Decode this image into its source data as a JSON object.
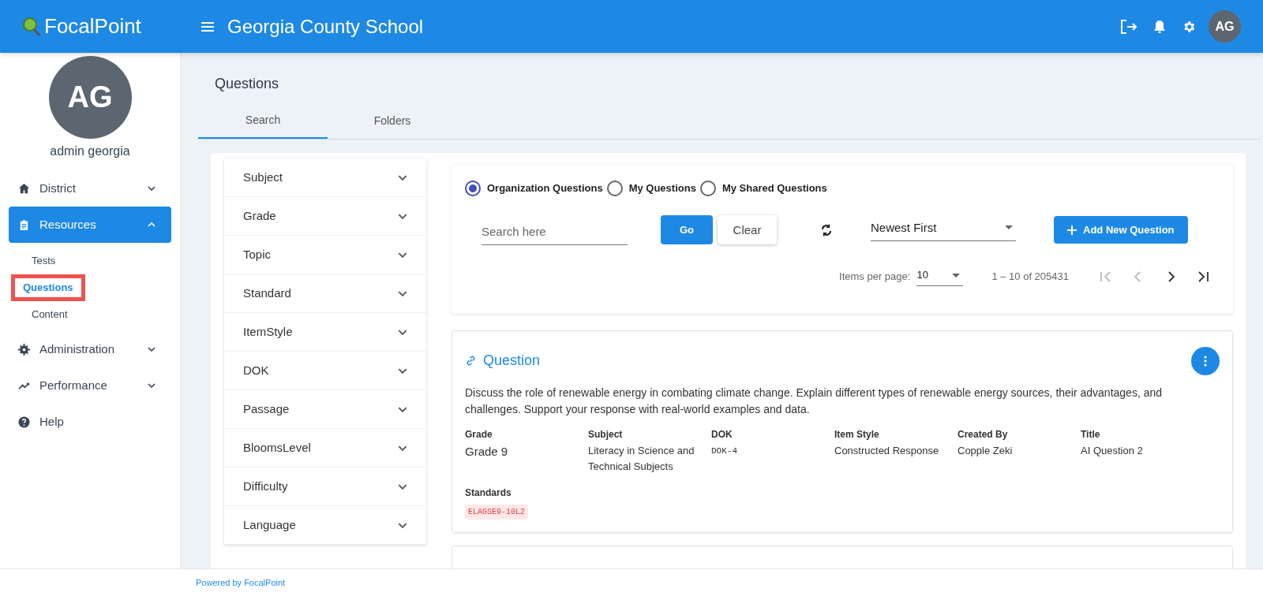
{
  "header": {
    "brand": "FocalPoint",
    "school": "Georgia County School",
    "avatar": "AG"
  },
  "user": {
    "initials": "AG",
    "name": "admin georgia"
  },
  "sidebar": {
    "items": [
      {
        "label": "District",
        "kind": "home",
        "expanded": false,
        "selected": false
      },
      {
        "label": "Resources",
        "kind": "clipboard",
        "expanded": true,
        "selected": true,
        "children": [
          {
            "label": "Tests",
            "selected": false
          },
          {
            "label": "Questions",
            "selected": true
          },
          {
            "label": "Content",
            "selected": false
          }
        ]
      },
      {
        "label": "Administration",
        "kind": "gear",
        "expanded": false,
        "selected": false
      },
      {
        "label": "Performance",
        "kind": "trend",
        "expanded": false,
        "selected": false
      },
      {
        "label": "Help",
        "kind": "help",
        "selected": false
      }
    ]
  },
  "page": {
    "title": "Questions"
  },
  "tabs": [
    {
      "label": "Search",
      "selected": true
    },
    {
      "label": "Folders",
      "selected": false
    }
  ],
  "filters": [
    "Subject",
    "Grade",
    "Topic",
    "Standard",
    "ItemStyle",
    "DOK",
    "Passage",
    "BloomsLevel",
    "Difficulty",
    "Language"
  ],
  "scope": [
    {
      "label": "Organization Questions",
      "selected": true
    },
    {
      "label": "My Questions",
      "selected": false
    },
    {
      "label": "My Shared Questions",
      "selected": false
    }
  ],
  "search": {
    "placeholder": "Search here",
    "go": "Go",
    "clear": "Clear"
  },
  "sort": {
    "value": "Newest First"
  },
  "add_button": "Add New Question",
  "pagination": {
    "label": "Items per page:",
    "per_page": "10",
    "range": "1 – 10 of 205431",
    "buttons": [
      {
        "kind": "first",
        "disabled": true
      },
      {
        "kind": "prev",
        "disabled": true
      },
      {
        "kind": "next",
        "disabled": false
      },
      {
        "kind": "last",
        "disabled": false
      }
    ]
  },
  "questions": [
    {
      "title": "Question",
      "text": "Discuss the role of renewable energy in combating climate change. Explain different types of renewable energy sources, their advantages, and challenges. Support your response with real-world examples and data.",
      "fields": [
        {
          "label": "Grade",
          "value": "Grade 9",
          "kind": "large"
        },
        {
          "label": "Subject",
          "value": "Literacy in Science and Technical Subjects",
          "kind": "text"
        },
        {
          "label": "DOK",
          "value": "DOK-4",
          "kind": "code"
        },
        {
          "label": "Item Style",
          "value": "Constructed Response",
          "kind": "text"
        },
        {
          "label": "Created By",
          "value": "Copple Zeki",
          "kind": "text"
        },
        {
          "label": "Title",
          "value": "AI Question 2",
          "kind": "text"
        }
      ],
      "standards_label": "Standards",
      "standards": [
        "ELAGSE9-10L2"
      ]
    }
  ],
  "footer": {
    "text": "Powered by FocalPoint"
  }
}
